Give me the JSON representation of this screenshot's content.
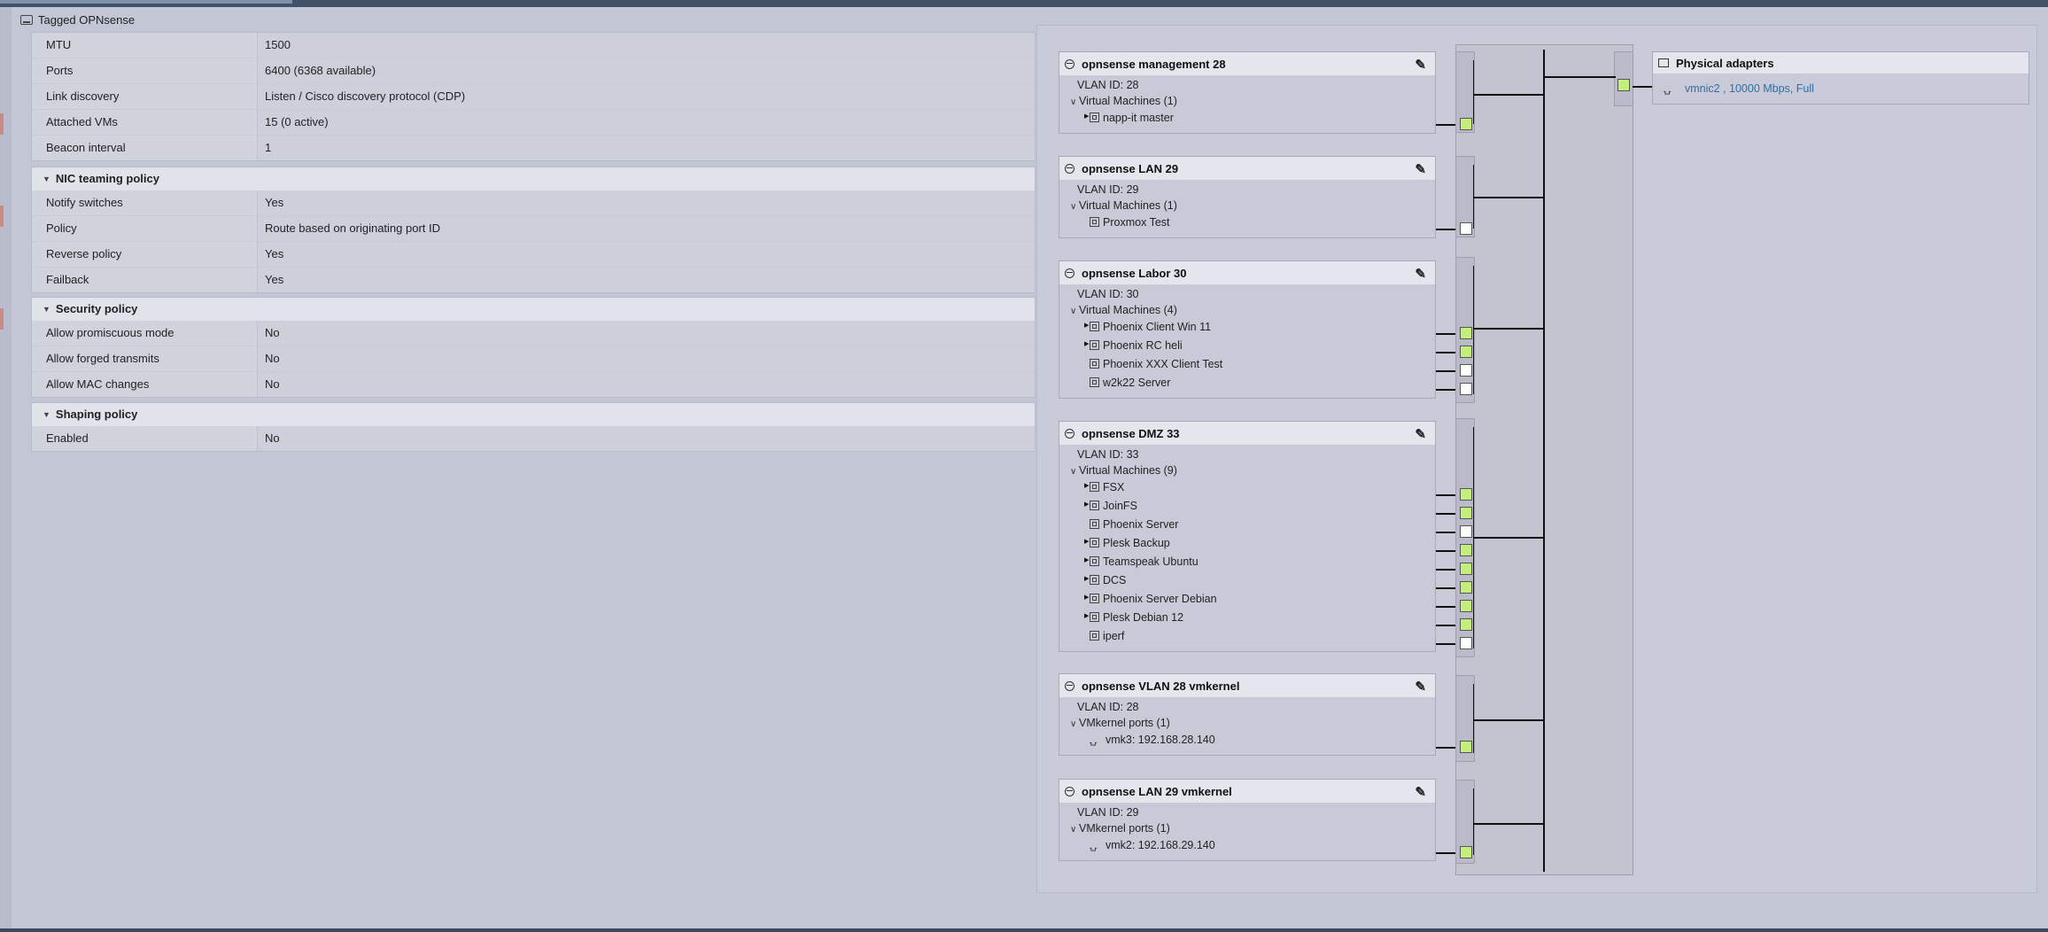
{
  "header": {
    "title": "Tagged OPNsense"
  },
  "properties": [
    {
      "label": "MTU",
      "value": "1500"
    },
    {
      "label": "Ports",
      "value": "6400 (6368 available)"
    },
    {
      "label": "Link discovery",
      "value": "Listen / Cisco discovery protocol (CDP)"
    },
    {
      "label": "Attached VMs",
      "value": "15 (0 active)"
    },
    {
      "label": "Beacon interval",
      "value": "1"
    }
  ],
  "nic_teaming": {
    "title": "NIC teaming policy",
    "rows": [
      {
        "label": "Notify switches",
        "value": "Yes"
      },
      {
        "label": "Policy",
        "value": "Route based on originating port ID"
      },
      {
        "label": "Reverse policy",
        "value": "Yes"
      },
      {
        "label": "Failback",
        "value": "Yes"
      }
    ]
  },
  "security": {
    "title": "Security policy",
    "rows": [
      {
        "label": "Allow promiscuous mode",
        "value": "No"
      },
      {
        "label": "Allow forged transmits",
        "value": "No"
      },
      {
        "label": "Allow MAC changes",
        "value": "No"
      }
    ]
  },
  "shaping": {
    "title": "Shaping policy",
    "rows": [
      {
        "label": "Enabled",
        "value": "No"
      }
    ]
  },
  "port_groups": [
    {
      "name": "opnsense management 28",
      "vlan": "VLAN ID: 28",
      "group_label": "Virtual Machines (1)",
      "items": [
        {
          "name": "napp-it master",
          "expandable": true,
          "connected": true
        }
      ]
    },
    {
      "name": "opnsense LAN 29",
      "vlan": "VLAN ID: 29",
      "group_label": "Virtual Machines (1)",
      "items": [
        {
          "name": "Proxmox Test",
          "expandable": false,
          "connected": false
        }
      ]
    },
    {
      "name": "opnsense Labor 30",
      "vlan": "VLAN ID: 30",
      "group_label": "Virtual Machines (4)",
      "items": [
        {
          "name": "Phoenix Client Win 11",
          "expandable": true,
          "connected": true
        },
        {
          "name": "Phoenix RC heli",
          "expandable": true,
          "connected": true
        },
        {
          "name": "Phoenix XXX Client Test",
          "expandable": false,
          "connected": false
        },
        {
          "name": "w2k22 Server",
          "expandable": false,
          "connected": false
        }
      ]
    },
    {
      "name": "opnsense DMZ 33",
      "vlan": "VLAN ID: 33",
      "group_label": "Virtual Machines (9)",
      "items": [
        {
          "name": "FSX",
          "expandable": true,
          "connected": true
        },
        {
          "name": "JoinFS",
          "expandable": true,
          "connected": true
        },
        {
          "name": "Phoenix Server",
          "expandable": false,
          "connected": false
        },
        {
          "name": "Plesk Backup",
          "expandable": true,
          "connected": true
        },
        {
          "name": "Teamspeak Ubuntu",
          "expandable": true,
          "connected": true
        },
        {
          "name": "DCS",
          "expandable": true,
          "connected": true
        },
        {
          "name": "Phoenix Server Debian",
          "expandable": true,
          "connected": true
        },
        {
          "name": "Plesk Debian 12",
          "expandable": true,
          "connected": true
        },
        {
          "name": "iperf",
          "expandable": false,
          "connected": false
        }
      ]
    },
    {
      "name": "opnsense VLAN 28 vmkernel",
      "vlan": "VLAN ID: 28",
      "group_label": "VMkernel ports (1)",
      "items": [
        {
          "name": "vmk3: 192.168.28.140",
          "kernel": true,
          "connected": true
        }
      ]
    },
    {
      "name": "opnsense LAN 29 vmkernel",
      "vlan": "VLAN ID: 29",
      "group_label": "VMkernel ports (1)",
      "items": [
        {
          "name": "vmk2: 192.168.29.140",
          "kernel": true,
          "connected": true
        }
      ]
    }
  ],
  "physical_adapters": {
    "title": "Physical adapters",
    "items": [
      {
        "name": "vmnic2 , 10000 Mbps, Full",
        "connected": true
      }
    ]
  },
  "colors": {
    "port_connected": "#c4ef7c",
    "port_disconnected": "#ffffff",
    "link": "#2f6ea8"
  }
}
